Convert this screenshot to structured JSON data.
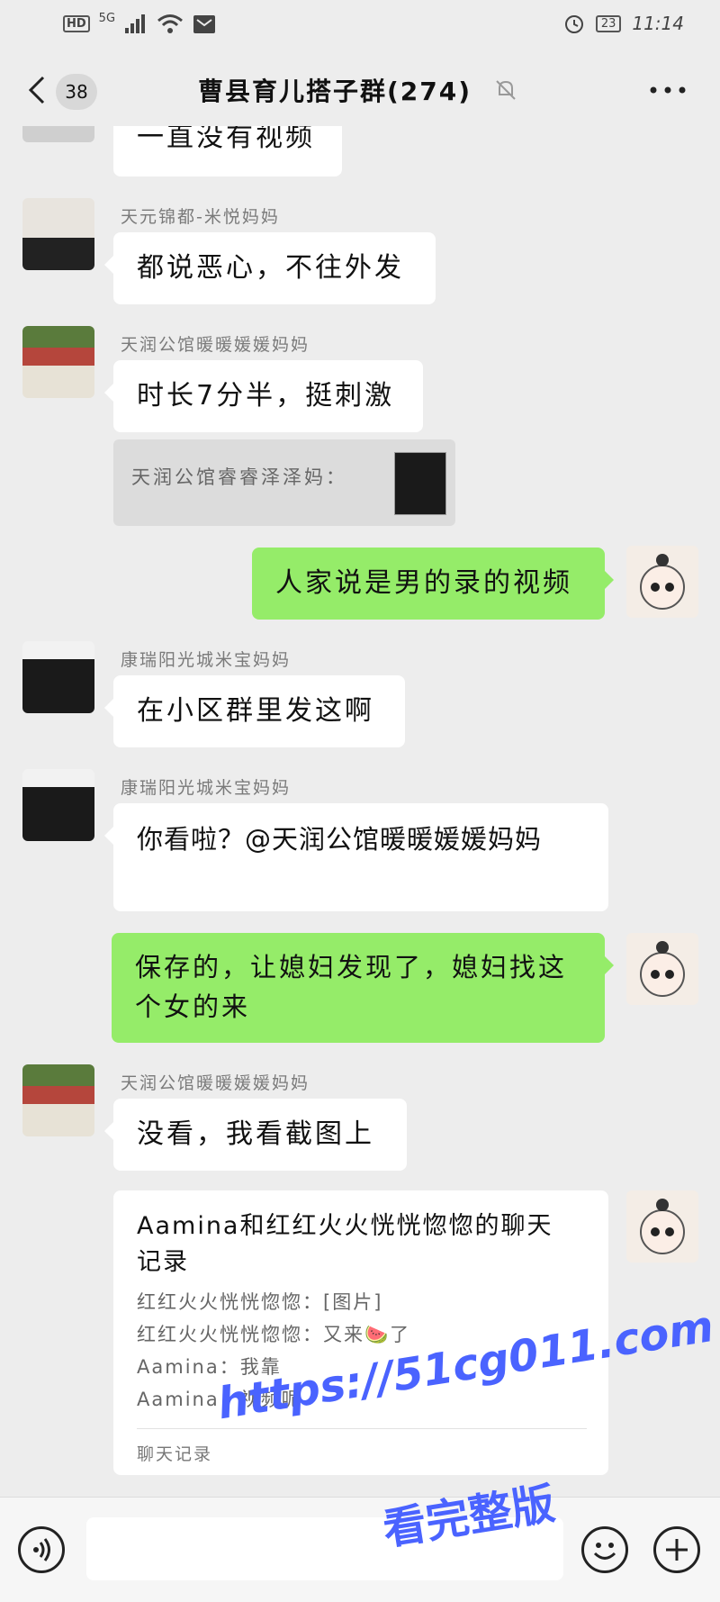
{
  "status_bar": {
    "network": "HD",
    "signal": "5G",
    "battery": "23",
    "time": "11:14"
  },
  "header": {
    "unread_count": "38",
    "title": "曹县育儿搭子群(274)"
  },
  "messages": [
    {
      "text": "一直没有视频"
    },
    {
      "sender": "天元锦都-米悦妈妈",
      "text": "都说恶心，不往外发"
    },
    {
      "sender": "天润公馆暖暖媛媛妈妈",
      "text": "时长7分半，挺刺激",
      "quote": "天润公馆睿睿泽泽妈："
    },
    {
      "text": "人家说是男的录的视频"
    },
    {
      "sender": "康瑞阳光城米宝妈妈",
      "text": "在小区群里发这啊"
    },
    {
      "sender": "康瑞阳光城米宝妈妈",
      "text": "你看啦？@天润公馆暖暖媛媛妈妈"
    },
    {
      "text_line1": "保存的，让媳妇发现了，媳妇找这",
      "text_line2": "个女的来"
    },
    {
      "sender": "天润公馆暖暖媛媛妈妈",
      "text": "没看，我看截图上"
    }
  ],
  "chat_record": {
    "title_line1": "Aamina和红红火火恍恍惚惚的聊天",
    "title_line2": "记录",
    "lines": [
      "红红火火恍恍惚惚：[图片]",
      "红红火火恍恍惚惚：又来🍉了",
      "Aamina：我靠",
      "Aamina：视频呢"
    ],
    "footer": "聊天记录"
  },
  "watermark": {
    "line1": "https://51cg011.com",
    "line2": "看完整版"
  },
  "colors": {
    "background": "#ededed",
    "own_bubble": "#95ec69",
    "watermark": "#4a63ff"
  }
}
